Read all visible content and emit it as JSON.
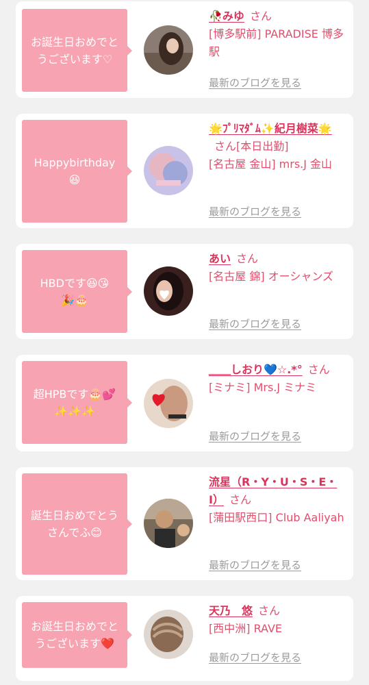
{
  "cards": [
    {
      "message": "お誕生日おめでと\nうございます♡",
      "name": "🥀みゆ",
      "san": "さん",
      "shop": "[博多駅前] PARADISE 博多駅",
      "blog": "最新のブログを見る"
    },
    {
      "message": "Happybirthday\n😆",
      "name": "🌟ﾌﾟﾘﾏﾀﾞﾑ✨紀月樹菜🌟",
      "san": "さん[本日出勤]",
      "shop": "[名古屋 金山] mrs.J 金山",
      "blog": "最新のブログを見る"
    },
    {
      "message": "HBDです😆😘\n🎉🎂",
      "name": "あい",
      "san": "さん",
      "shop": "[名古屋 錦] オーシャンズ",
      "blog": "最新のブログを見る"
    },
    {
      "message": "超HPBです🎂💕\n✨✨✨",
      "name": "＿＿しおり💙☆.*°",
      "san": "さん",
      "shop": "[ミナミ] Mrs.J ミナミ",
      "blog": "最新のブログを見る"
    },
    {
      "message": "誕生日おめでとう\nさんでふ😊",
      "name": "流星（R・Y・U・S・E・I）",
      "san": "さん",
      "shop": "[蒲田駅西口] Club Aaliyah",
      "blog": "最新のブログを見る"
    },
    {
      "message": "お誕生日おめでと\nうございます❤️",
      "name": "天乃　悠",
      "san": "さん",
      "shop": "[西中洲] RAVE",
      "blog": "最新のブログを見る"
    }
  ]
}
